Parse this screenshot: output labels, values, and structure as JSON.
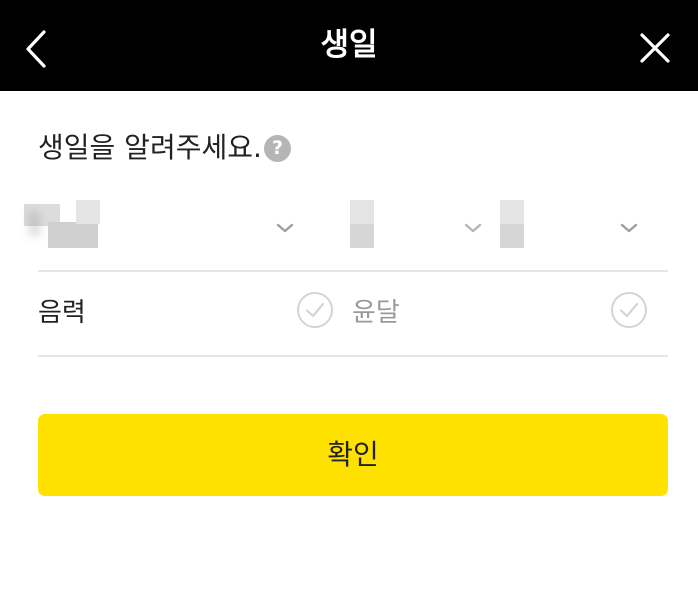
{
  "header": {
    "title": "생일",
    "back_icon": "chevron-left-icon",
    "close_icon": "close-icon",
    "background": "#000000"
  },
  "form": {
    "question": "생일을 알려주세요.",
    "help_icon": "?",
    "selects": {
      "year": {
        "value": "1",
        "chevron_icon": "chevron-down-icon"
      },
      "month": {
        "value": "",
        "chevron_icon": "chevron-down-icon"
      },
      "day": {
        "value": "",
        "chevron_icon": "chevron-down-icon"
      }
    },
    "options": [
      {
        "label": "음력",
        "checked": false
      },
      {
        "label": "윤달",
        "checked": false
      }
    ]
  },
  "confirm": {
    "label": "확인",
    "color": "#ffe100"
  }
}
